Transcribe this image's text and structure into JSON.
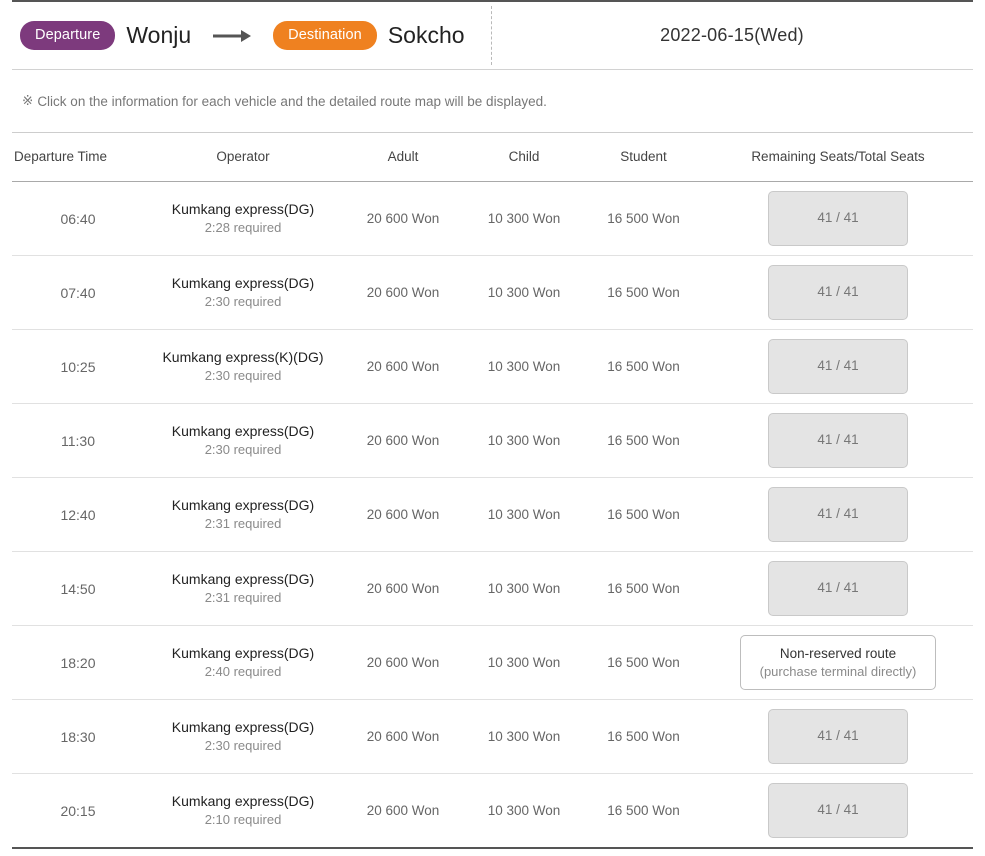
{
  "header": {
    "departure_badge": "Departure",
    "departure_city": "Wonju",
    "arrow_icon": "arrow-right-icon",
    "destination_badge": "Destination",
    "destination_city": "Sokcho",
    "date": "2022-06-15(Wed)"
  },
  "notice": {
    "mark": "※",
    "text": "Click on the information for each vehicle and the detailed route map will be displayed."
  },
  "table": {
    "columns": [
      "Departure Time",
      "Operator",
      "Adult",
      "Child",
      "Student",
      "Remaining Seats/Total Seats"
    ],
    "rows": [
      {
        "time": "06:40",
        "operator": "Kumkang express(DG)",
        "duration": "2:28 required",
        "adult": "20 600 Won",
        "child": "10 300 Won",
        "student": "16 500 Won",
        "seats": "41 / 41",
        "seats_sub": "",
        "seats_type": "available"
      },
      {
        "time": "07:40",
        "operator": "Kumkang express(DG)",
        "duration": "2:30 required",
        "adult": "20 600 Won",
        "child": "10 300 Won",
        "student": "16 500 Won",
        "seats": "41 / 41",
        "seats_sub": "",
        "seats_type": "available"
      },
      {
        "time": "10:25",
        "operator": "Kumkang express(K)(DG)",
        "duration": "2:30 required",
        "adult": "20 600 Won",
        "child": "10 300 Won",
        "student": "16 500 Won",
        "seats": "41 / 41",
        "seats_sub": "",
        "seats_type": "available"
      },
      {
        "time": "11:30",
        "operator": "Kumkang express(DG)",
        "duration": "2:30 required",
        "adult": "20 600 Won",
        "child": "10 300 Won",
        "student": "16 500 Won",
        "seats": "41 / 41",
        "seats_sub": "",
        "seats_type": "available"
      },
      {
        "time": "12:40",
        "operator": "Kumkang express(DG)",
        "duration": "2:31 required",
        "adult": "20 600 Won",
        "child": "10 300 Won",
        "student": "16 500 Won",
        "seats": "41 / 41",
        "seats_sub": "",
        "seats_type": "available"
      },
      {
        "time": "14:50",
        "operator": "Kumkang express(DG)",
        "duration": "2:31 required",
        "adult": "20 600 Won",
        "child": "10 300 Won",
        "student": "16 500 Won",
        "seats": "41 / 41",
        "seats_sub": "",
        "seats_type": "available"
      },
      {
        "time": "18:20",
        "operator": "Kumkang express(DG)",
        "duration": "2:40 required",
        "adult": "20 600 Won",
        "child": "10 300 Won",
        "student": "16 500 Won",
        "seats": "Non-reserved route",
        "seats_sub": "(purchase terminal directly)",
        "seats_type": "non-reserved"
      },
      {
        "time": "18:30",
        "operator": "Kumkang express(DG)",
        "duration": "2:30 required",
        "adult": "20 600 Won",
        "child": "10 300 Won",
        "student": "16 500 Won",
        "seats": "41 / 41",
        "seats_sub": "",
        "seats_type": "available"
      },
      {
        "time": "20:15",
        "operator": "Kumkang express(DG)",
        "duration": "2:10 required",
        "adult": "20 600 Won",
        "child": "10 300 Won",
        "student": "16 500 Won",
        "seats": "41 / 41",
        "seats_sub": "",
        "seats_type": "available"
      }
    ]
  },
  "colors": {
    "departure_badge": "#7d3a7d",
    "destination_badge": "#ef8120",
    "seat_button_bg": "#e4e4e4",
    "rule_dark": "#555555"
  }
}
